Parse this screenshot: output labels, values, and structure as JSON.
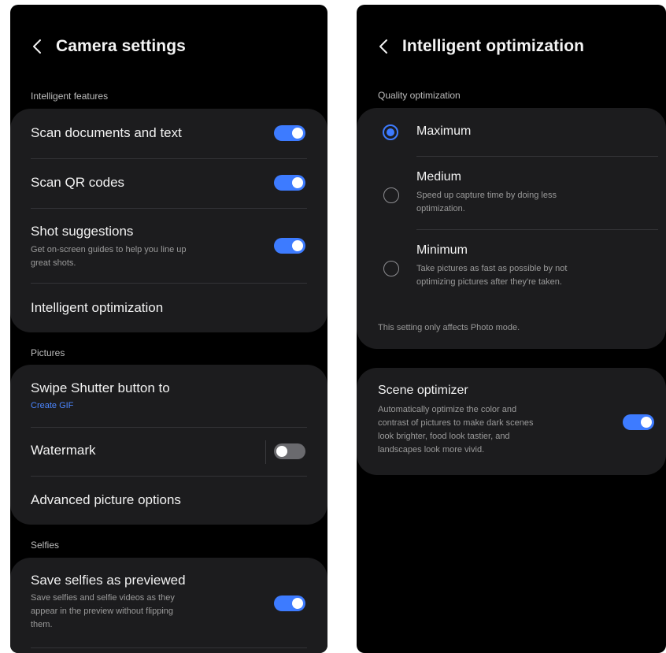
{
  "left": {
    "title": "Camera settings",
    "sections": {
      "intelligent": "Intelligent features",
      "pictures": "Pictures",
      "selfies": "Selfies"
    },
    "items": {
      "scan_docs": {
        "title": "Scan documents and text",
        "toggle": "on"
      },
      "scan_qr": {
        "title": "Scan QR codes",
        "toggle": "on"
      },
      "shot_suggestions": {
        "title": "Shot suggestions",
        "subtitle_line1": "Get on-screen guides to help you line up",
        "subtitle_line2": "great shots.",
        "toggle": "on"
      },
      "intelligent_opt": {
        "title": "Intelligent optimization"
      },
      "swipe_shutter": {
        "title": "Swipe Shutter button to",
        "value": "Create GIF"
      },
      "watermark": {
        "title": "Watermark",
        "toggle": "off"
      },
      "advanced_picture": {
        "title": "Advanced picture options"
      },
      "save_selfies": {
        "title": "Save selfies as previewed",
        "subtitle_line1": "Save selfies and selfie videos as they",
        "subtitle_line2": "appear in the preview without flipping",
        "subtitle_line3": "them.",
        "toggle": "on"
      }
    }
  },
  "right": {
    "title": "Intelligent optimization",
    "section": "Quality optimization",
    "options": [
      {
        "title": "Maximum",
        "selected": true
      },
      {
        "title": "Medium",
        "subtitle_line1": "Speed up capture time by doing less",
        "subtitle_line2": "optimization.",
        "selected": false
      },
      {
        "title": "Minimum",
        "subtitle_line1": "Take pictures as fast as possible by not",
        "subtitle_line2": "optimizing pictures after they're taken.",
        "selected": false
      }
    ],
    "note": "This setting only affects Photo mode.",
    "scene": {
      "title": "Scene optimizer",
      "line1": "Automatically optimize the color and",
      "line2": "contrast of pictures to make dark scenes",
      "line3": "look brighter, food look tastier, and",
      "line4": "landscapes look more vivid.",
      "toggle": "on"
    }
  },
  "colors": {
    "accent": "#3d7bff",
    "card": "#1c1c1e",
    "background": "#000000",
    "link": "#4b86ff"
  },
  "icons": {
    "back": "chevron-left-icon"
  }
}
